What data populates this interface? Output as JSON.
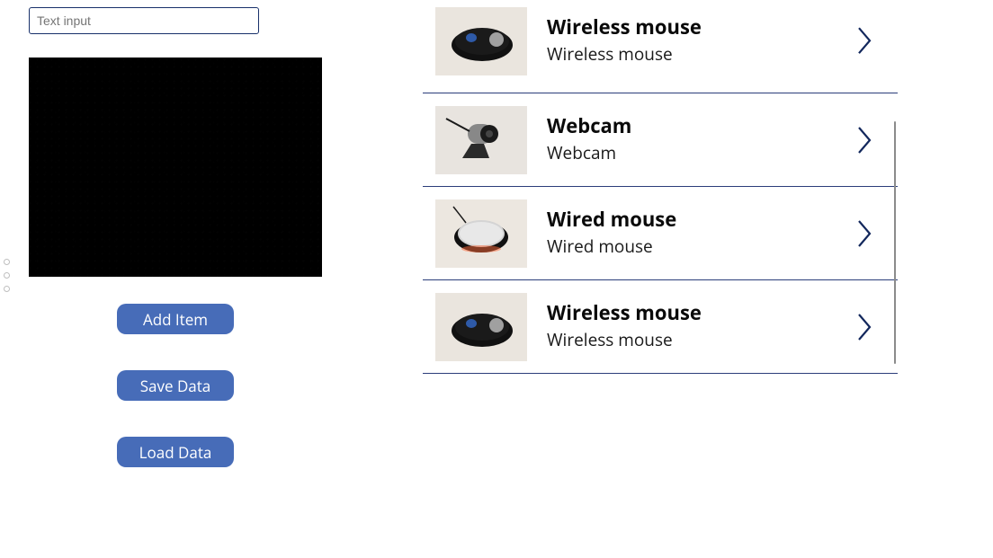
{
  "left": {
    "input_placeholder": "Text input",
    "input_value": "",
    "buttons": {
      "add": "Add Item",
      "save": "Save Data",
      "load": "Load Data"
    }
  },
  "items": [
    {
      "title": "Wireless mouse",
      "subtitle": "Wireless mouse",
      "thumb": "wireless-mouse"
    },
    {
      "title": "Webcam",
      "subtitle": "Webcam",
      "thumb": "webcam"
    },
    {
      "title": "Wired mouse",
      "subtitle": "Wired mouse",
      "thumb": "wired-mouse"
    },
    {
      "title": "Wireless mouse",
      "subtitle": "Wireless mouse",
      "thumb": "wireless-mouse"
    }
  ],
  "colors": {
    "accent": "#476cb8",
    "border": "#18306a"
  }
}
